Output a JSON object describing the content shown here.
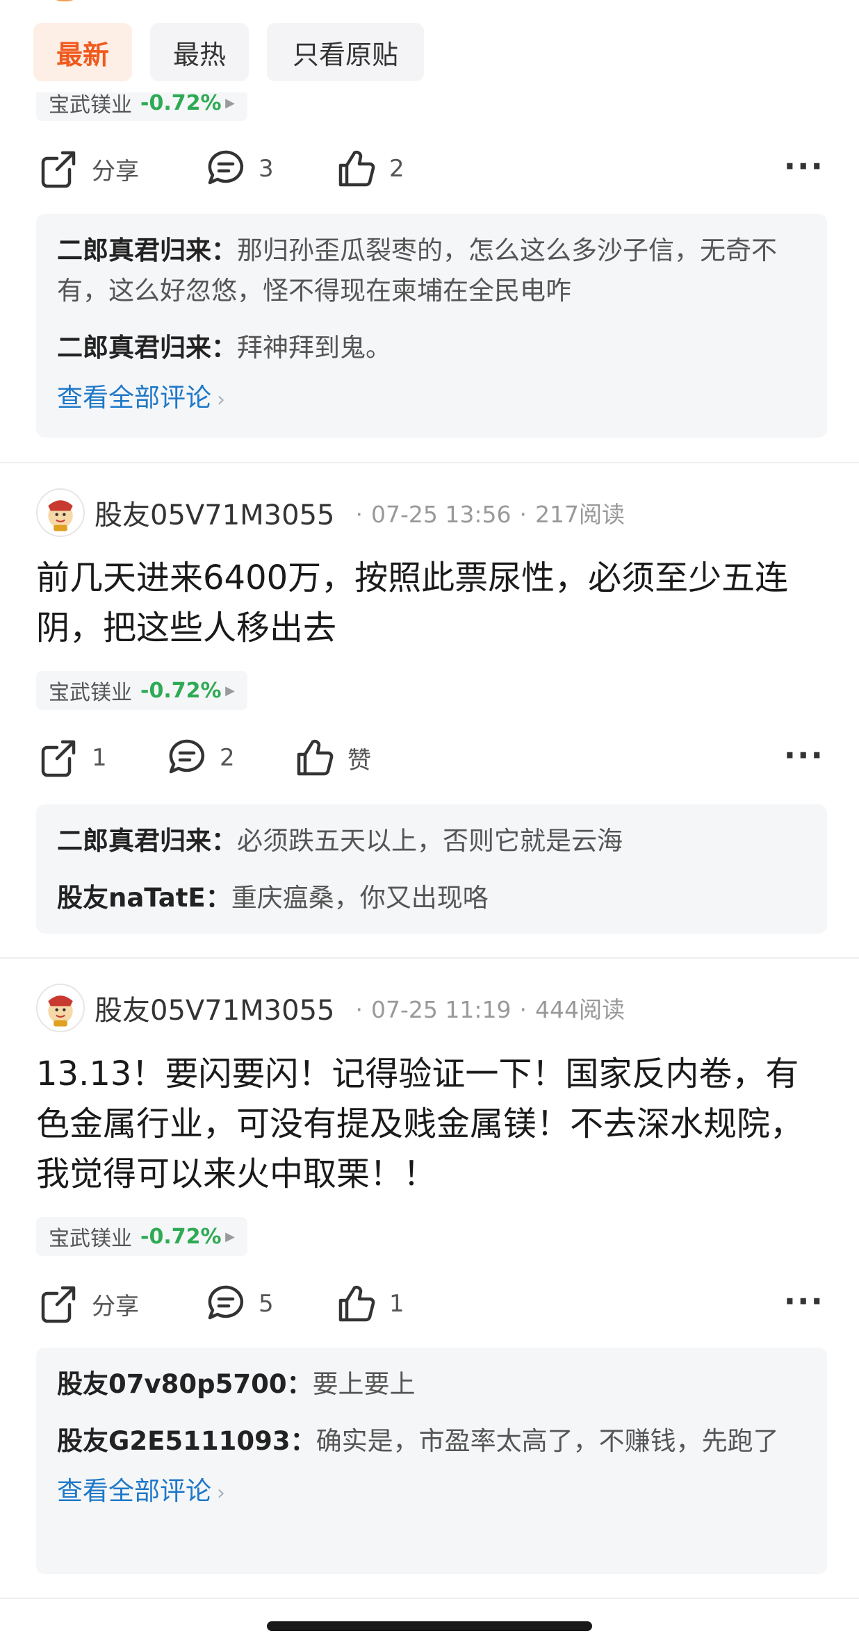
{
  "tabs": [
    {
      "label": "最新",
      "active": true
    },
    {
      "label": "最热",
      "active": false
    },
    {
      "label": "只看原贴",
      "active": false
    }
  ],
  "colors": {
    "accent": "#f05a1e",
    "stock_up_down": "#2eaa54",
    "link": "#1e78c8"
  },
  "posts": [
    {
      "stock": {
        "name": "宝武镁业",
        "change": "-0.72%"
      },
      "actions": {
        "share": "分享",
        "comments": "3",
        "likes": "2"
      },
      "comments": [
        {
          "author": "二郎真君归来：",
          "text": "那归孙歪瓜裂枣的，怎么这么多沙子信，无奇不有，这么好忽悠，怪不得现在柬埔在全民电咋"
        },
        {
          "author": "二郎真君归来：",
          "text": "拜神拜到鬼。"
        }
      ],
      "view_all": "查看全部评论"
    },
    {
      "user": "股友05V71M3055",
      "time": "07-25 13:56",
      "reads": "217阅读",
      "text": "前几天进来6400万，按照此票尿性，必须至少五连阴，把这些人移出去",
      "stock": {
        "name": "宝武镁业",
        "change": "-0.72%"
      },
      "actions": {
        "share": "1",
        "comments": "2",
        "likes": "赞"
      },
      "comments": [
        {
          "author": "二郎真君归来：",
          "text": "必须跌五天以上，否则它就是云海"
        },
        {
          "author": "股友naTatE：",
          "text": "重庆瘟桑，你又出现咯"
        }
      ]
    },
    {
      "user": "股友05V71M3055",
      "time": "07-25 11:19",
      "reads": "444阅读",
      "text": "13.13！要闪要闪！记得验证一下！国家反内卷，有色金属行业，可没有提及贱金属镁！不去深水规院，我觉得可以来火中取栗！！",
      "stock": {
        "name": "宝武镁业",
        "change": "-0.72%"
      },
      "actions": {
        "share": "分享",
        "comments": "5",
        "likes": "1"
      },
      "comments": [
        {
          "author": "股友07v80p5700：",
          "text": "要上要上"
        },
        {
          "author": "股友G2E5111093：",
          "text": "确实是，市盈率太高了，不赚钱，先跑了"
        }
      ],
      "view_all": "查看全部评论"
    }
  ],
  "more_icon": "ellipsis-icon"
}
